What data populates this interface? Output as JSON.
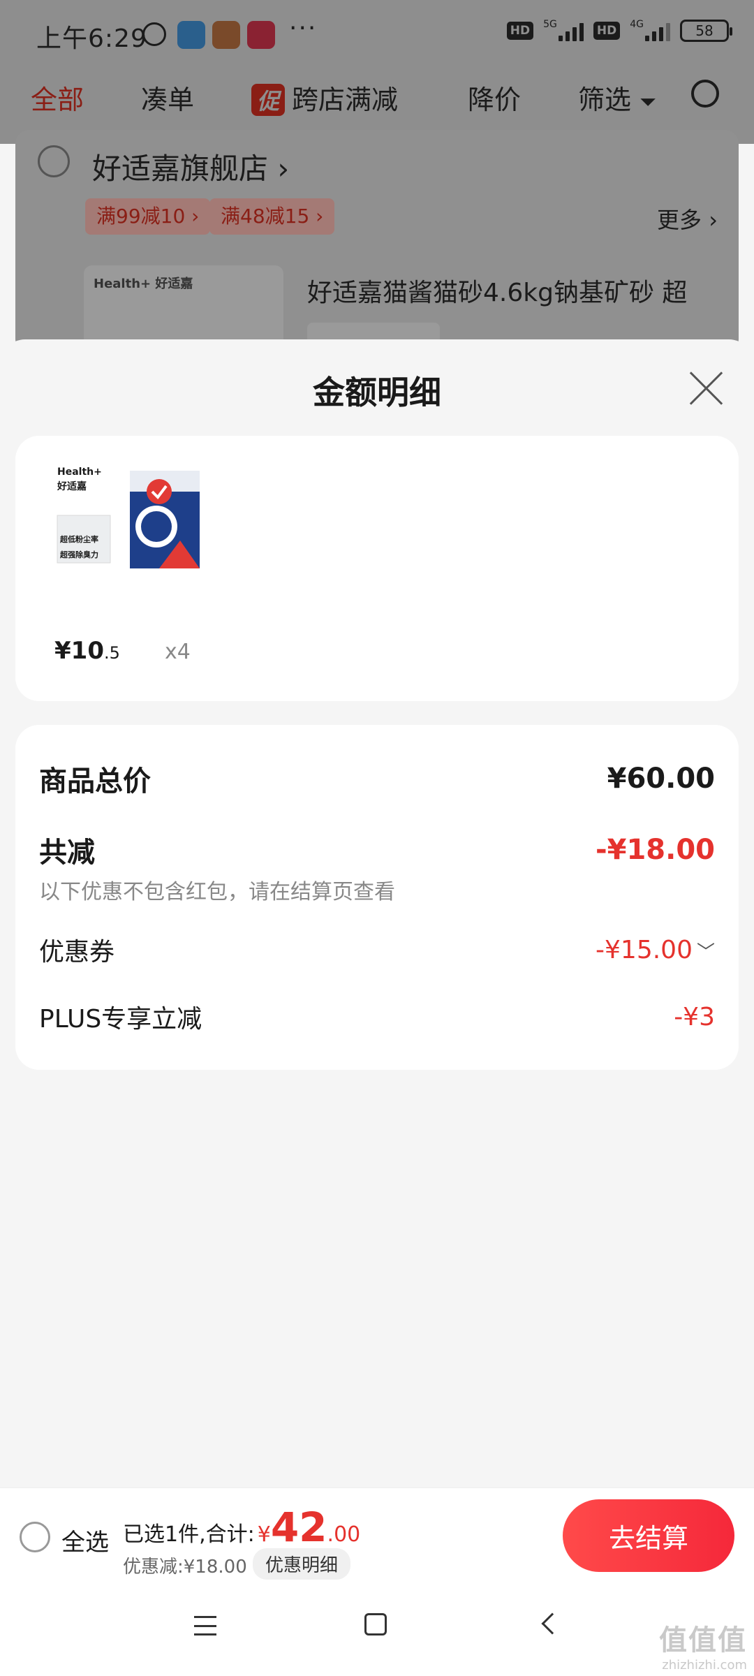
{
  "status_bar": {
    "time": "上午6:29",
    "more": "···",
    "hd1": "HD",
    "net1": "5G",
    "hd2": "HD",
    "net2": "4G",
    "battery": "58"
  },
  "bg": {
    "tabs": [
      "全部",
      "凑单",
      "跨店满减",
      "降价",
      "筛选"
    ],
    "promo_badge": "促",
    "store_name": "好适嘉旗舰店 ›",
    "coupons": [
      "满99减10 ›",
      "满48减15 ›"
    ],
    "more": "更多 ›",
    "product_title": "好适嘉猫酱猫砂4.6kg钠基矿砂 超",
    "thumb_text": "Health+ 好适嘉"
  },
  "sheet": {
    "title": "金额明细",
    "product": {
      "price_int": "¥10",
      "price_dec": ".5",
      "qty": "x4",
      "brand": "Health+",
      "brand_cn": "好适嘉",
      "tag1": "超低粉尘率",
      "tag2": "超强除臭力"
    },
    "summary": {
      "total_label": "商品总价",
      "total_value": "¥60.00",
      "reduce_label": "共减",
      "reduce_value": "-¥18.00",
      "note": "以下优惠不包含红包，请在结算页查看",
      "coupon_label": "优惠券",
      "coupon_value": "-¥15.00",
      "plus_label": "PLUS专享立减",
      "plus_value": "-¥3"
    }
  },
  "bottom": {
    "select_all": "全选",
    "selected": "已选1件,合计:",
    "yen": "¥",
    "amount_int": "42",
    "amount_dec": ".00",
    "discount": "优惠减:¥18.00",
    "detail_btn": "优惠明细",
    "checkout_btn": "去结算"
  },
  "watermark": {
    "main": "值值值",
    "sub": "zhizhizhi.com"
  },
  "colors": {
    "accent": "#e5322d",
    "background": "#f5f5f5"
  }
}
